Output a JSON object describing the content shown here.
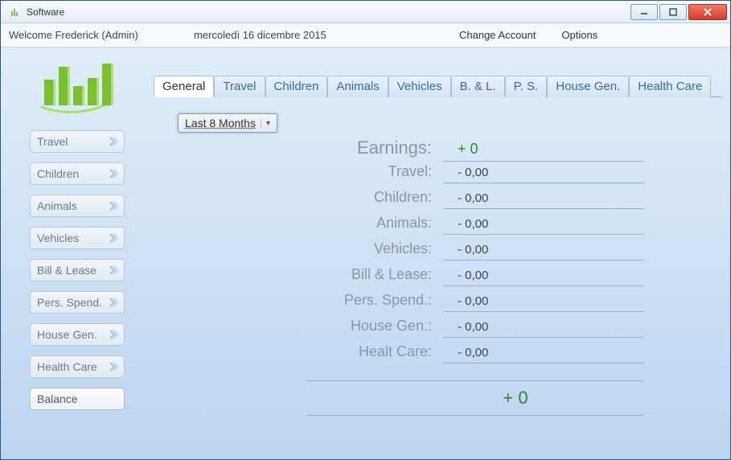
{
  "window": {
    "title": "Software"
  },
  "header": {
    "welcome": "Welcome Frederick   (Admin)",
    "date": "mercoledì 16 dicembre 2015",
    "change_account": "Change Account",
    "options": "Options"
  },
  "sidebar": {
    "items": [
      {
        "label": "Travel"
      },
      {
        "label": "Children"
      },
      {
        "label": "Animals"
      },
      {
        "label": "Vehicles"
      },
      {
        "label": "Bill & Lease"
      },
      {
        "label": "Pers. Spend."
      },
      {
        "label": "House Gen."
      },
      {
        "label": "Health Care"
      },
      {
        "label": "Balance"
      }
    ]
  },
  "tabs": [
    {
      "label": "General"
    },
    {
      "label": "Travel"
    },
    {
      "label": "Children"
    },
    {
      "label": "Animals"
    },
    {
      "label": "Vehicles"
    },
    {
      "label": "B. & L."
    },
    {
      "label": "P. S."
    },
    {
      "label": "House Gen."
    },
    {
      "label": "Health Care"
    }
  ],
  "period_selector": {
    "label": "Last 8 Months"
  },
  "summary": {
    "earnings_label": "Earnings:",
    "earnings_value": "+ 0",
    "rows": [
      {
        "label": "Travel:",
        "value": "- 0,00"
      },
      {
        "label": "Children:",
        "value": "- 0,00"
      },
      {
        "label": "Animals:",
        "value": "- 0,00"
      },
      {
        "label": "Vehicles:",
        "value": "- 0,00"
      },
      {
        "label": "Bill & Lease:",
        "value": "- 0,00"
      },
      {
        "label": "Pers. Spend.:",
        "value": "- 0,00"
      },
      {
        "label": "House Gen.:",
        "value": "- 0,00"
      },
      {
        "label": "Healt Care:",
        "value": "- 0,00"
      }
    ],
    "total": "+ 0"
  }
}
